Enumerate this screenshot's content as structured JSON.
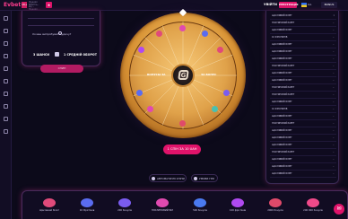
{
  "header": {
    "logo": "Evbet",
    "age_badge": "18+",
    "licence_text": "Ліцензія КРАІЛ №... від ... Ліцензія ...",
    "promo_icon": "star-icon",
    "login_label": "УВІЙТИ",
    "register_label": "РЕЄСТРАЦІЯ",
    "language": "UA",
    "bonus_label": "BONUS"
  },
  "stake_card": {
    "question": "Хочеш випробувати удачу?",
    "choice_chance": "3 ШАНСИ",
    "choice_medium": "1 СРЕДНІЙ ОБОРОТ",
    "stake_button": "СПИН"
  },
  "wheel": {
    "left_label": "БОНУСЫ ЗА",
    "right_label": "ЗА БОНУС"
  },
  "spin_button": "1 СПІН ЗА 10 UAH",
  "auto_button": "АВТОМАТИЧНІ СПІНИ",
  "rules_button": "УМОВИ ГРИ",
  "history": {
    "rows": [
      {
        "name": "ЩАСЛИВИЙ БІЛЕТ",
        "num": "1"
      },
      {
        "name": "ПЛАТИНОВИЙ БІЛЕТ",
        "num": "..."
      },
      {
        "name": "ЩАСЛИВИЙ БІЛЕТ",
        "num": "..."
      },
      {
        "name": "10 ФРІСПИНІВ",
        "num": "..."
      },
      {
        "name": "ЩАСЛИВИЙ БІЛЕТ",
        "num": "..."
      },
      {
        "name": "ЩАСЛИВИЙ БІЛЕТ",
        "num": "..."
      },
      {
        "name": "ЩАСЛИВИЙ БІЛЕТ",
        "num": "..."
      },
      {
        "name": "ПЛАТИНОВИЙ БІЛЕТ",
        "num": "..."
      },
      {
        "name": "ЩАСЛИВИЙ БІЛЕТ",
        "num": "..."
      },
      {
        "name": "ЩАСЛИВИЙ БІЛЕТ",
        "num": "..."
      },
      {
        "name": "ПЛАТИНОВИЙ БІЛЕТ",
        "num": "..."
      },
      {
        "name": "ПЛАТИНОВИЙ БІЛЕТ",
        "num": "..."
      },
      {
        "name": "ЩАСЛИВИЙ БІЛЕТ",
        "num": "..."
      },
      {
        "name": "10 ФРІСПИНІВ",
        "num": "..."
      },
      {
        "name": "ЩАСЛИВИЙ БІЛЕТ",
        "num": "..."
      },
      {
        "name": "ПЛАТИНОВИЙ БІЛЕТ",
        "num": "..."
      },
      {
        "name": "ЩАСЛИВИЙ БІЛЕТ",
        "num": "..."
      },
      {
        "name": "ЩАСЛИВИЙ БІЛЕТ",
        "num": "..."
      },
      {
        "name": "ЩАСЛИВИЙ БІЛЕТ",
        "num": "..."
      },
      {
        "name": "ПЛАТИНОВИЙ БІЛЕТ",
        "num": "..."
      },
      {
        "name": "ЩАСЛИВИЙ БІЛЕТ",
        "num": "..."
      },
      {
        "name": "ЩАСЛИВИЙ БІЛЕТ",
        "num": "..."
      },
      {
        "name": "ЩАСЛИВИЙ БІЛЕТ",
        "num": "..."
      }
    ]
  },
  "prizes": [
    {
      "label": "Щасливий білет",
      "color": "#e04a7a"
    },
    {
      "label": "10 Фріспінів",
      "color": "#5a6cf0"
    },
    {
      "label": "200 бонусів",
      "color": "#7a5cf0"
    },
    {
      "label": "ПЛАТИНОВИЙ БІЛ",
      "color": "#e04ab0"
    },
    {
      "label": "500 бонусів",
      "color": "#4a7af0"
    },
    {
      "label": "100 фріспінів",
      "color": "#b04af0"
    },
    {
      "label": "2000 бонусів",
      "color": "#e04a6a"
    },
    {
      "label": "200 000 бонусів",
      "color": "#f04a8a"
    }
  ],
  "colors": {
    "accent": "#e0136a",
    "wheel_gold": "#d89234",
    "background": "#0c0a1a"
  }
}
